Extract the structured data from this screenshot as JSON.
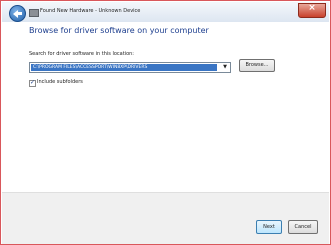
{
  "window": {
    "title": "Found New Hardware - Unknown Device",
    "close_label": "×"
  },
  "main": {
    "heading": "Browse for driver software on your computer",
    "search_label": "Search for driver software in this location:",
    "path_value": "C:\\PROGRAM FILES\\ACCESSPORT\\WIN8XP\\DRIVERS",
    "browse_label": "Browse...",
    "include_subfolders_label": "Include subfolders",
    "include_subfolders_checked": true,
    "check_glyph": "✓",
    "combo_arrow_glyph": "▼"
  },
  "footer": {
    "next_label": "Next",
    "cancel_label": "Cancel"
  }
}
